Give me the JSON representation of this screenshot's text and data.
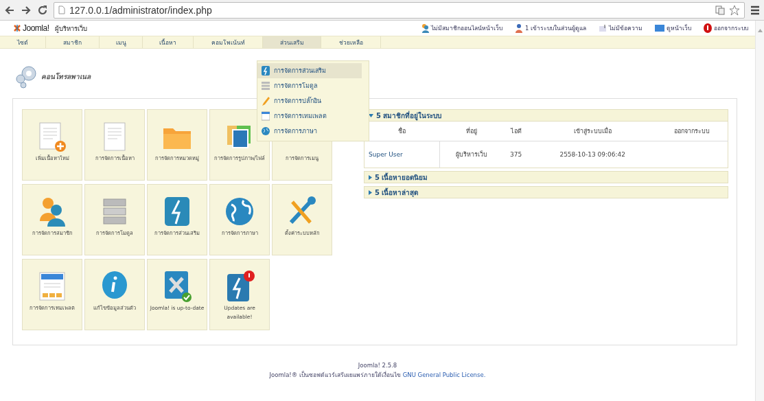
{
  "browser": {
    "url": "127.0.0.1/administrator/index.php"
  },
  "header": {
    "logo": "Joomla!",
    "title": "ผู้บริหารเว็บ",
    "status": [
      {
        "label": "ไม่มีสมาชิกออนไลน์หน้าเว็บ"
      },
      {
        "label": "1 เข้าระบบในส่วนผู้ดูแล"
      },
      {
        "label": "ไม่มีข้อความ"
      },
      {
        "label": "ดูหน้าเว็บ"
      },
      {
        "label": "ออกจากระบบ"
      }
    ]
  },
  "menu": [
    {
      "label": "ไซต์",
      "selected": false
    },
    {
      "label": "สมาชิก",
      "selected": false
    },
    {
      "label": "เมนู",
      "selected": false
    },
    {
      "label": "เนื้อหา",
      "selected": false
    },
    {
      "label": "คอมโพเน้นท์",
      "selected": false
    },
    {
      "label": "ส่วนเสริม",
      "selected": true
    },
    {
      "label": "ช่วยเหลือ",
      "selected": false
    }
  ],
  "dropdown": [
    {
      "label": "การจัดการส่วนเสริม",
      "selected": true
    },
    {
      "label": "การจัดการโมดูล",
      "selected": false
    },
    {
      "label": "การจัดการปลั๊กอิน",
      "selected": false
    },
    {
      "label": "การจัดการเทมเพลต",
      "selected": false
    },
    {
      "label": "การจัดการภาษา",
      "selected": false
    }
  ],
  "page_title": "คอนโทรลพาเนล",
  "tiles": [
    {
      "label": "เพิ่มเนื้อหาใหม่"
    },
    {
      "label": "การจัดการเนื้อหา"
    },
    {
      "label": "การจัดการหมวดหมู่"
    },
    {
      "label": "การจัดการรูปภาพ/ไฟล์"
    },
    {
      "label": "การจัดการเมนู"
    },
    {
      "label": "การจัดการสมาชิก"
    },
    {
      "label": "การจัดการโมดูล"
    },
    {
      "label": "การจัดการส่วนเสริม"
    },
    {
      "label": "การจัดการภาษา"
    },
    {
      "label": "ตั้งค่าระบบหลัก"
    },
    {
      "label": "การจัดการเทมเพลต"
    },
    {
      "label": "แก้ไขข้อมูลส่วนตัว"
    },
    {
      "label": "Joomla! is up-to-date"
    },
    {
      "label": "Updates are available!"
    }
  ],
  "modules": [
    {
      "title": "5 สมาชิกที่อยู่ในระบบ",
      "expanded": true,
      "columns": [
        "ชื่อ",
        "ที่อยู่",
        "ไอดี",
        "เข้าสู่ระบบเมื่อ",
        "ออกจากระบบ"
      ],
      "rows": [
        [
          "Super User",
          "ผู้บริหารเว็บ",
          "375",
          "2558-10-13 09:06:42"
        ]
      ]
    },
    {
      "title": "5 เนื้อหายอดนิยม",
      "expanded": false
    },
    {
      "title": "5 เนื้อหาล่าสุด",
      "expanded": false
    }
  ],
  "footer": {
    "version": "Joomla! 2.5.8",
    "license_text": "Joomla!® เป็นซอฟต์แวร์เสรีเผยแพร่ภายใต้เงื่อนไข",
    "license_link": "GNU General Public License."
  }
}
